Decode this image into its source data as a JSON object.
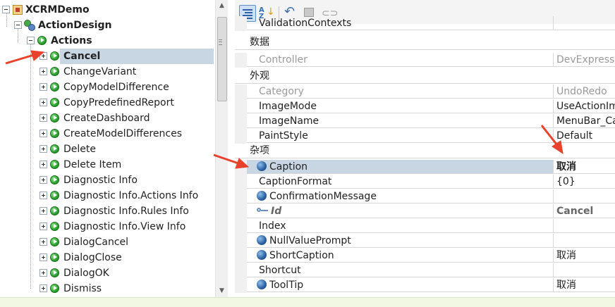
{
  "tree": {
    "root": {
      "label": "XCRMDemo"
    },
    "model": {
      "label": "ActionDesign"
    },
    "group": {
      "label": "Actions"
    },
    "items": [
      {
        "label": "Cancel",
        "selected": true
      },
      {
        "label": "ChangeVariant"
      },
      {
        "label": "CopyModelDifference"
      },
      {
        "label": "CopyPredefinedReport"
      },
      {
        "label": "CreateDashboard"
      },
      {
        "label": "CreateModelDifferences"
      },
      {
        "label": "Delete"
      },
      {
        "label": "Delete Item"
      },
      {
        "label": "Diagnostic Info"
      },
      {
        "label": "Diagnostic Info.Actions Info"
      },
      {
        "label": "Diagnostic Info.Rules Info"
      },
      {
        "label": "Diagnostic Info.View Info"
      },
      {
        "label": "DialogCancel"
      },
      {
        "label": "DialogClose"
      },
      {
        "label": "DialogOK"
      },
      {
        "label": "Dismiss"
      }
    ]
  },
  "toolbar": {
    "buttons": [
      {
        "icon": "categorized-icon",
        "active": true
      },
      {
        "icon": "alphabetical-sort-icon",
        "active": false
      },
      {
        "icon": "undo-icon",
        "active": false
      },
      {
        "icon": "property-pages-icon",
        "active": false
      },
      {
        "icon": "link-icon",
        "active": false
      }
    ]
  },
  "grid": {
    "rows": [
      {
        "kind": "prop",
        "name": "ValidationContexts",
        "value": ""
      },
      {
        "kind": "category",
        "name": "数据"
      },
      {
        "kind": "prop",
        "name": "Controller",
        "value": "DevExpress.E",
        "readonly": true
      },
      {
        "kind": "category",
        "name": "外观"
      },
      {
        "kind": "prop",
        "name": "Category",
        "value": "UndoRedo",
        "readonly": true
      },
      {
        "kind": "prop",
        "name": "ImageMode",
        "value": "UseActionIma"
      },
      {
        "kind": "prop",
        "name": "ImageName",
        "value": "MenuBar_Ca"
      },
      {
        "kind": "prop",
        "name": "PaintStyle",
        "value": "Default"
      },
      {
        "kind": "category",
        "name": "杂项"
      },
      {
        "kind": "prop",
        "name": "Caption",
        "value": "取消",
        "icon": "globe-icon",
        "selected": true,
        "bold": true
      },
      {
        "kind": "prop",
        "name": "CaptionFormat",
        "value": "{0}"
      },
      {
        "kind": "prop",
        "name": "ConfirmationMessage",
        "value": "",
        "icon": "globe-icon"
      },
      {
        "kind": "prop",
        "name": "Id",
        "value": "Cancel",
        "icon": "key-icon",
        "italic": true
      },
      {
        "kind": "prop",
        "name": "Index",
        "value": ""
      },
      {
        "kind": "prop",
        "name": "NullValuePrompt",
        "value": "",
        "icon": "globe-icon"
      },
      {
        "kind": "prop",
        "name": "ShortCaption",
        "value": "取消",
        "icon": "globe-icon"
      },
      {
        "kind": "prop",
        "name": "Shortcut",
        "value": ""
      },
      {
        "kind": "prop",
        "name": "ToolTip",
        "value": "取消",
        "icon": "globe-icon"
      }
    ]
  },
  "colors": {
    "selection": "#c8d6e4",
    "annotation_arrow": "#e8412c",
    "grid_line": "#d7d7d7"
  }
}
